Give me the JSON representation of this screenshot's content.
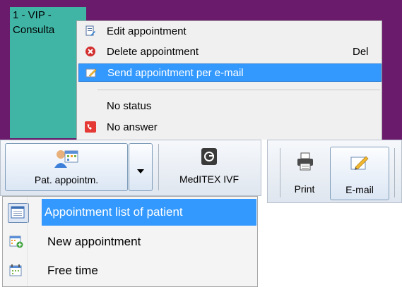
{
  "appointment": {
    "title": "1 - VIP -",
    "subtitle": "Consulta"
  },
  "context_menu": {
    "items": [
      {
        "label": "Edit appointment",
        "shortcut": "",
        "icon": "edit-appointment-icon"
      },
      {
        "label": "Delete appointment",
        "shortcut": "Del",
        "icon": "delete-icon"
      },
      {
        "label": "Send appointment per e-mail",
        "shortcut": "",
        "icon": "email-pen-icon",
        "highlighted": true
      },
      {
        "label": "No status",
        "shortcut": "",
        "icon": ""
      },
      {
        "label": "No answer",
        "shortcut": "",
        "icon": "phone-icon"
      }
    ]
  },
  "toolbar": {
    "pat_appointm_label": "Pat. appointm.",
    "meditex_label": "MedITEX IVF",
    "print_label": "Print",
    "email_label": "E-mail"
  },
  "dropdown_menu": {
    "items": [
      {
        "label": "Appointment list of patient",
        "icon": "list-icon",
        "highlighted": true
      },
      {
        "label": "New appointment",
        "icon": "calendar-add-icon"
      },
      {
        "label": "Free time",
        "icon": "calendar-clock-icon"
      }
    ]
  },
  "colors": {
    "appointment_bg": "#6a1b6b",
    "appointment_teal": "#40b5a6",
    "highlight": "#3399ff"
  }
}
